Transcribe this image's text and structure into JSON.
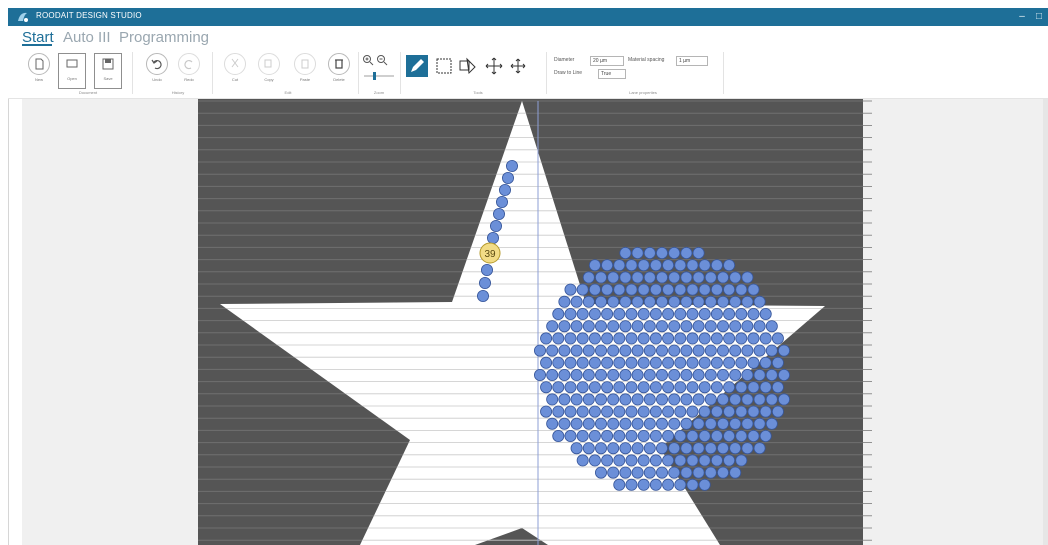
{
  "app": {
    "title": "ROODAIT DESIGN STUDIO",
    "minimize_glyph": "–",
    "maximize_glyph": "□"
  },
  "tabs": [
    {
      "label": "Start",
      "active": true
    },
    {
      "label": "Auto III",
      "active": false
    },
    {
      "label": "Programming",
      "active": false
    }
  ],
  "ribbon": {
    "buttons": {
      "new": "New",
      "open": "Open",
      "save": "Save",
      "undo": "Undo",
      "redo": "Redo",
      "cut": "Cut",
      "copy": "Copy",
      "paste": "Paste",
      "delete": "Delete"
    },
    "groups": {
      "document": "Document",
      "history": "History",
      "edit": "Edit",
      "zoom": "Zoom",
      "tools": "Tools",
      "lane": "Lane properties"
    },
    "props": {
      "diameter_label": "Diameter",
      "diameter_value": "20 µm",
      "spacing_label": "Material spacing",
      "spacing_value": "1 µm",
      "drawmode_label": "Draw to Line",
      "drawmode_value": "True"
    },
    "zoom_level": 0.35
  },
  "canvas": {
    "badge_number": "39",
    "colors": {
      "dark": "#555555",
      "star": "#ffffff",
      "dot": "#6b8fd8",
      "dot_stroke": "#37569a",
      "badge": "#f2dc86"
    }
  }
}
